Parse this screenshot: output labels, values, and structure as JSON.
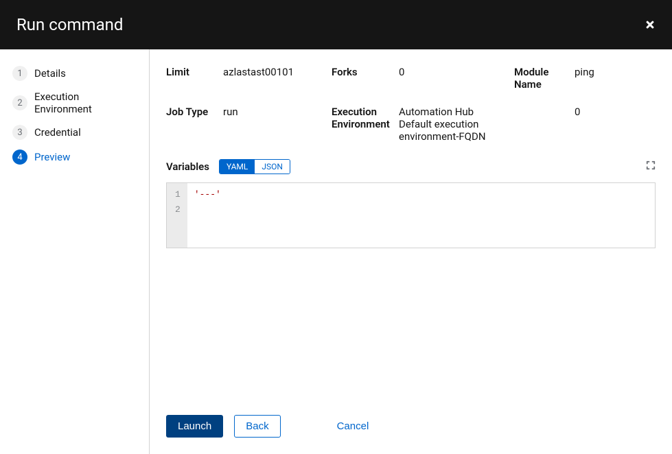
{
  "header": {
    "title": "Run command"
  },
  "sidebar": {
    "steps": [
      {
        "number": "1",
        "label": "Details",
        "active": false
      },
      {
        "number": "2",
        "label": "Execution Environment",
        "active": false
      },
      {
        "number": "3",
        "label": "Credential",
        "active": false
      },
      {
        "number": "4",
        "label": "Preview",
        "active": true
      }
    ]
  },
  "details": {
    "limit_label": "Limit",
    "limit_value": "azlastast00101",
    "forks_label": "Forks",
    "forks_value": "0",
    "module_name_label": "Module Name",
    "module_name_value": "ping",
    "job_type_label": "Job Type",
    "job_type_value": "run",
    "exec_env_label": "Execution Environment",
    "exec_env_value": "Automation Hub Default execution environment-FQDN",
    "extra_label": "",
    "extra_value": "0"
  },
  "variables": {
    "label": "Variables",
    "toggle_yaml": "YAML",
    "toggle_json": "JSON",
    "lines": [
      {
        "num": "1",
        "content": "'---'"
      },
      {
        "num": "2",
        "content": ""
      }
    ]
  },
  "footer": {
    "launch": "Launch",
    "back": "Back",
    "cancel": "Cancel"
  }
}
